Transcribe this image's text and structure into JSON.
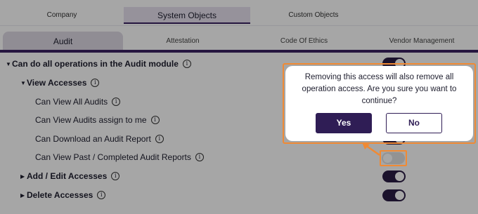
{
  "top_tabs": [
    "Company",
    "System Objects",
    "Custom Objects"
  ],
  "sub_tabs": [
    "Audit",
    "Attestation",
    "Code Of Ethics",
    "Vendor Management"
  ],
  "permissions": {
    "module": "Can do all operations in the Audit module",
    "view_group": "View Accesses",
    "view_items": [
      "Can View All Audits",
      "Can View Audits assign to me",
      "Can Download an Audit Report",
      "Can View Past / Completed Audit Reports"
    ],
    "add_group": "Add / Edit Accesses",
    "delete_group": "Delete Accesses"
  },
  "toggles": {
    "module": true,
    "view_group": true,
    "view_all": true,
    "view_assigned": true,
    "download": true,
    "past_reports": false,
    "add_group": true,
    "delete_group": true
  },
  "dialog": {
    "message": "Removing this access will also remove all operation access. Are you sure you want to continue?",
    "yes": "Yes",
    "no": "No"
  },
  "icons": {
    "info": "info-icon",
    "expand": "caret-down-icon",
    "collapse": "caret-right-icon"
  },
  "colors": {
    "primary": "#2f1d55",
    "highlight": "#f08a34",
    "toggle_on": "#2a1c44",
    "toggle_off": "#e2e2e2"
  }
}
